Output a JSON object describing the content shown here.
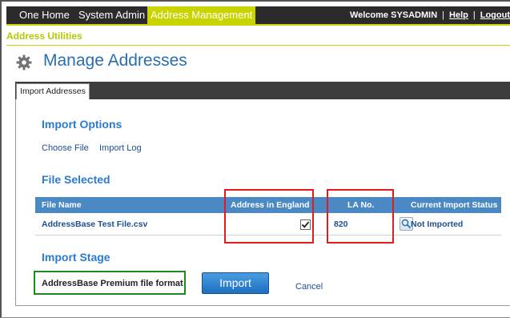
{
  "nav": {
    "one_home": "One Home",
    "system_admin": "System Admin",
    "address_management": "Address Management"
  },
  "account": {
    "welcome": "Welcome  SYSADMIN",
    "help": "Help",
    "logout": "Logout"
  },
  "utilities_label": "Address Utilities",
  "page_title": "Manage Addresses",
  "tabs": [
    "Import Addresses"
  ],
  "import_options": {
    "heading": "Import Options",
    "choose_file": "Choose File",
    "import_log": "Import Log"
  },
  "file_selected": {
    "heading": "File Selected",
    "columns": [
      "File Name",
      "Address in England",
      "LA No.",
      "Current Import Status"
    ],
    "rows": [
      {
        "file_name": "AddressBase Test File.csv",
        "address_in_england": true,
        "la_no": "820",
        "status": "Not Imported"
      }
    ]
  },
  "import_stage": {
    "heading": "Import Stage",
    "format": "AddressBase Premium file format",
    "import_button": "Import",
    "cancel": "Cancel"
  },
  "colors": {
    "nav_bg": "#2b2b2b",
    "accent": "#c9d400",
    "heading_blue": "#2a7bd0",
    "table_header": "#4a89c4",
    "highlight_red": "#e21c1c",
    "highlight_green": "#1d8a22"
  },
  "icons": {
    "gear": "gear-icon",
    "checkmark": "checkmark-icon",
    "lookup": "magnifier-icon"
  }
}
